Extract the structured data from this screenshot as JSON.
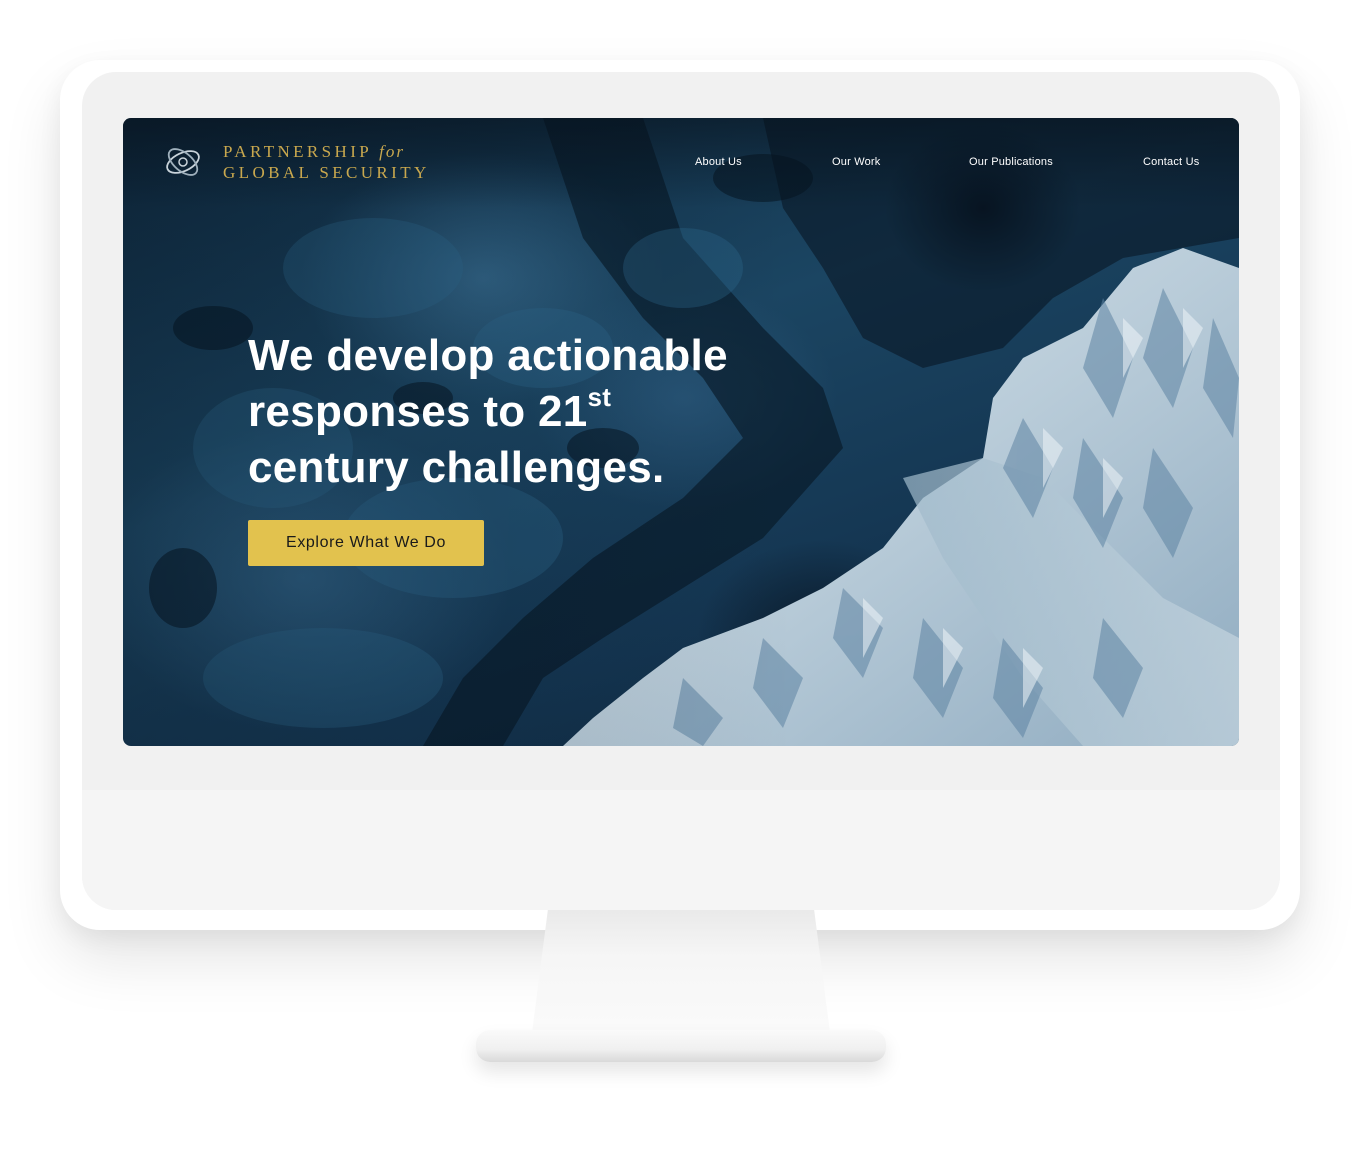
{
  "brand": {
    "name_line1": "PARTNERSHIP",
    "name_for": "for",
    "name_line2": "GLOBAL SECURITY",
    "accent_color": "#c9a84e",
    "logo_icon": "orbit-globe-icon"
  },
  "nav": {
    "items": [
      {
        "label": "About Us"
      },
      {
        "label": "Our Work"
      },
      {
        "label": "Our Publications"
      },
      {
        "label": "Contact Us"
      }
    ]
  },
  "hero": {
    "headline_part1": "We develop actionable responses to 21",
    "headline_sup": "st",
    "headline_part2": "century challenges.",
    "cta_label": "Explore What We Do",
    "cta_color": "#e2c24e"
  }
}
